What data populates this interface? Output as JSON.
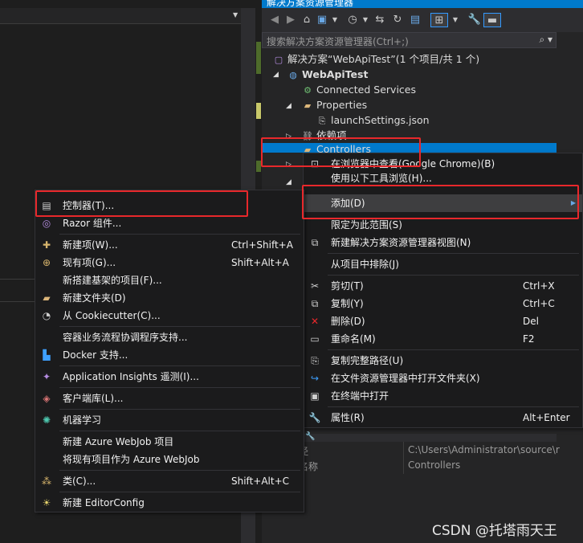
{
  "solution_explorer": {
    "title": "解决方案资源管理器",
    "search_placeholder": "搜索解决方案资源管理器(Ctrl+;)",
    "tree": {
      "solution": "解决方案“WebApiTest”(1 个项目/共 1 个)",
      "project": "WebApiTest",
      "connected": "Connected Services",
      "properties": "Properties",
      "launch": "launchSettings.json",
      "deps": "依赖项",
      "controllers": "Controllers"
    },
    "props": {
      "path_label": "径",
      "path_value": "C:\\Users\\Administrator\\source\\r",
      "name_label": "名称",
      "name_value": "Controllers"
    }
  },
  "context_menu": {
    "items": [
      {
        "label": "在浏览器中查看(Google Chrome)(B)",
        "shortcut": ""
      },
      {
        "label": "使用以下工具浏览(H)...",
        "shortcut": ""
      },
      {
        "label": "添加(D)",
        "shortcut": ""
      },
      {
        "label": "限定为此范围(S)",
        "shortcut": ""
      },
      {
        "label": "新建解决方案资源管理器视图(N)",
        "shortcut": ""
      },
      {
        "label": "从项目中排除(J)",
        "shortcut": ""
      },
      {
        "label": "剪切(T)",
        "shortcut": "Ctrl+X"
      },
      {
        "label": "复制(Y)",
        "shortcut": "Ctrl+C"
      },
      {
        "label": "删除(D)",
        "shortcut": "Del"
      },
      {
        "label": "重命名(M)",
        "shortcut": "F2"
      },
      {
        "label": "复制完整路径(U)",
        "shortcut": ""
      },
      {
        "label": "在文件资源管理器中打开文件夹(X)",
        "shortcut": ""
      },
      {
        "label": "在终端中打开",
        "shortcut": ""
      },
      {
        "label": "属性(R)",
        "shortcut": "Alt+Enter"
      }
    ]
  },
  "add_submenu": {
    "items": [
      {
        "label": "控制器(T)...",
        "shortcut": ""
      },
      {
        "label": "Razor 组件...",
        "shortcut": ""
      },
      {
        "label": "新建项(W)...",
        "shortcut": "Ctrl+Shift+A"
      },
      {
        "label": "现有项(G)...",
        "shortcut": "Shift+Alt+A"
      },
      {
        "label": "新搭建基架的项目(F)...",
        "shortcut": ""
      },
      {
        "label": "新建文件夹(D)",
        "shortcut": ""
      },
      {
        "label": "从 Cookiecutter(C)...",
        "shortcut": ""
      },
      {
        "label": "容器业务流程协调程序支持...",
        "shortcut": ""
      },
      {
        "label": "Docker 支持...",
        "shortcut": ""
      },
      {
        "label": "Application Insights 遥测(I)...",
        "shortcut": ""
      },
      {
        "label": "客户端库(L)...",
        "shortcut": ""
      },
      {
        "label": "机器学习",
        "shortcut": ""
      },
      {
        "label": "新建 Azure WebJob 项目",
        "shortcut": ""
      },
      {
        "label": "将现有项目作为 Azure WebJob",
        "shortcut": ""
      },
      {
        "label": "类(C)...",
        "shortcut": "Shift+Alt+C"
      },
      {
        "label": "新建 EditorConfig",
        "shortcut": ""
      }
    ]
  },
  "watermark": "CSDN @托塔雨天王",
  "colors": {
    "accent": "#007acc",
    "highlight_box": "#e8282b",
    "menu_bg": "#1b1b1c"
  }
}
